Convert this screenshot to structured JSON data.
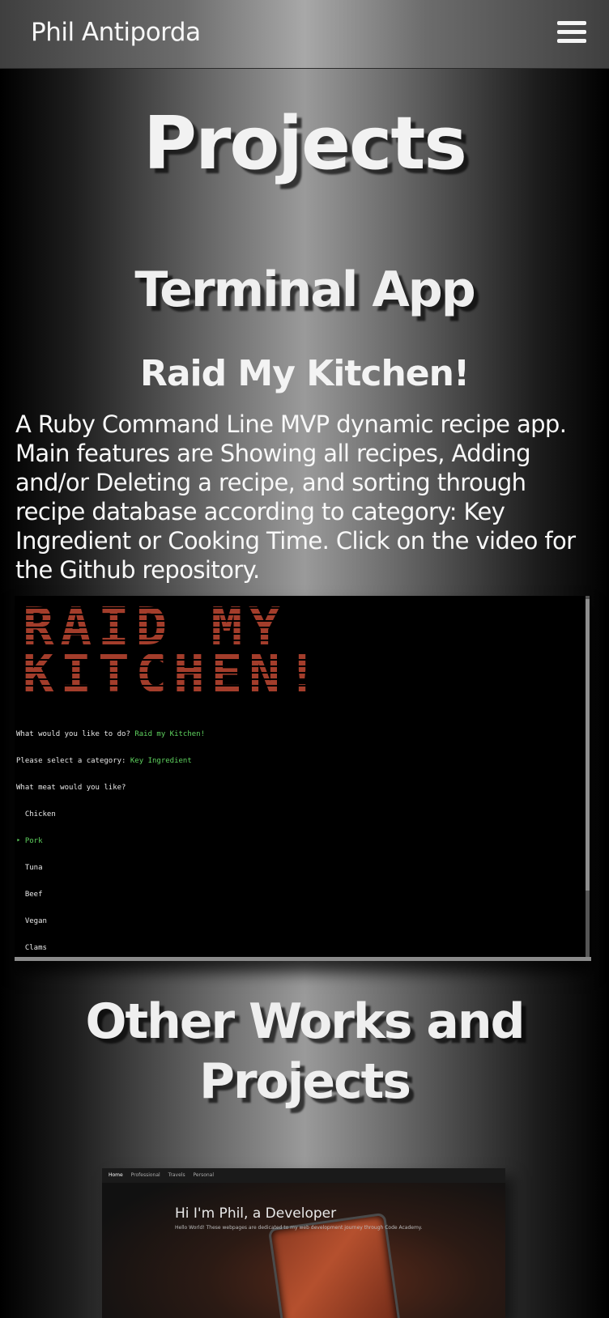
{
  "nav": {
    "brand": "Phil Antiporda",
    "menu_icon": "hamburger-menu-icon"
  },
  "page": {
    "title": "Projects"
  },
  "terminal_section": {
    "heading": "Terminal App",
    "project_name": "Raid My Kitchen!",
    "description": "A Ruby Command Line MVP dynamic recipe app. Main features are Showing all recipes, Adding and/or Deleting a recipe, and sorting through recipe database according to category: Key Ingredient or Cooking Time. Click on the video for the Github repository."
  },
  "video": {
    "banner": "RAID MY KITCHEN!",
    "lines": [
      {
        "prompt": "What would you like to do? ",
        "answer": "Raid my Kitchen!"
      },
      {
        "prompt": "Please select a category: ",
        "answer": "Key Ingredient"
      },
      {
        "prompt": "What meat would you like?",
        "answer": ""
      }
    ],
    "options": [
      {
        "label": "Chicken",
        "selected": false
      },
      {
        "label": "Pork",
        "selected": true
      },
      {
        "label": "Tuna",
        "selected": false
      },
      {
        "label": "Beef",
        "selected": false
      },
      {
        "label": "Vegan",
        "selected": false
      },
      {
        "label": "Clams",
        "selected": false
      }
    ]
  },
  "other_section": {
    "heading": "Other Works and Projects"
  },
  "thumbnail": {
    "nav_items": [
      "Home",
      "Professional",
      "Travels",
      "Personal"
    ],
    "heading": "Hi I'm Phil, a Developer",
    "subtext": "Hello World! These webpages are dedicated to my web development journey through Code Academy."
  },
  "colors": {
    "accent_red": "#b54430",
    "terminal_green": "#5fd35f"
  }
}
